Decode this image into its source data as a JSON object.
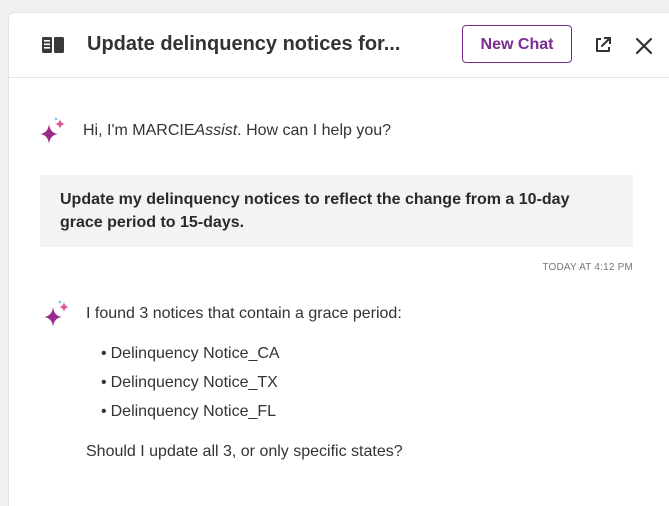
{
  "header": {
    "title": "Update delinquency notices for...",
    "new_chat_label": "New Chat",
    "icons": {
      "panel": "book-icon",
      "popout": "external-link-icon",
      "close": "close-icon"
    }
  },
  "colors": {
    "accent": "#7b2c8f",
    "sparkle_purple": "#9b2a8f",
    "sparkle_pink": "#e0559a",
    "sparkle_blue": "#6fb6e6",
    "user_bubble_bg": "#f3f3f3"
  },
  "messages": {
    "greeting": {
      "prefix": "Hi, I'm MARCIE",
      "brand_italic": "Assist",
      "suffix": ". How can I help you?"
    },
    "user": {
      "text": "Update my delinquency notices to reflect the change from a 10-day grace period to 15-days.",
      "timestamp": "TODAY AT 4:12 PM"
    },
    "reply": {
      "intro": "I found 3 notices that contain a grace period:",
      "notices": [
        "Delinquency Notice_CA",
        "Delinquency Notice_TX",
        "Delinquency Notice_FL"
      ],
      "question": "Should I update all 3, or only specific states?"
    }
  }
}
